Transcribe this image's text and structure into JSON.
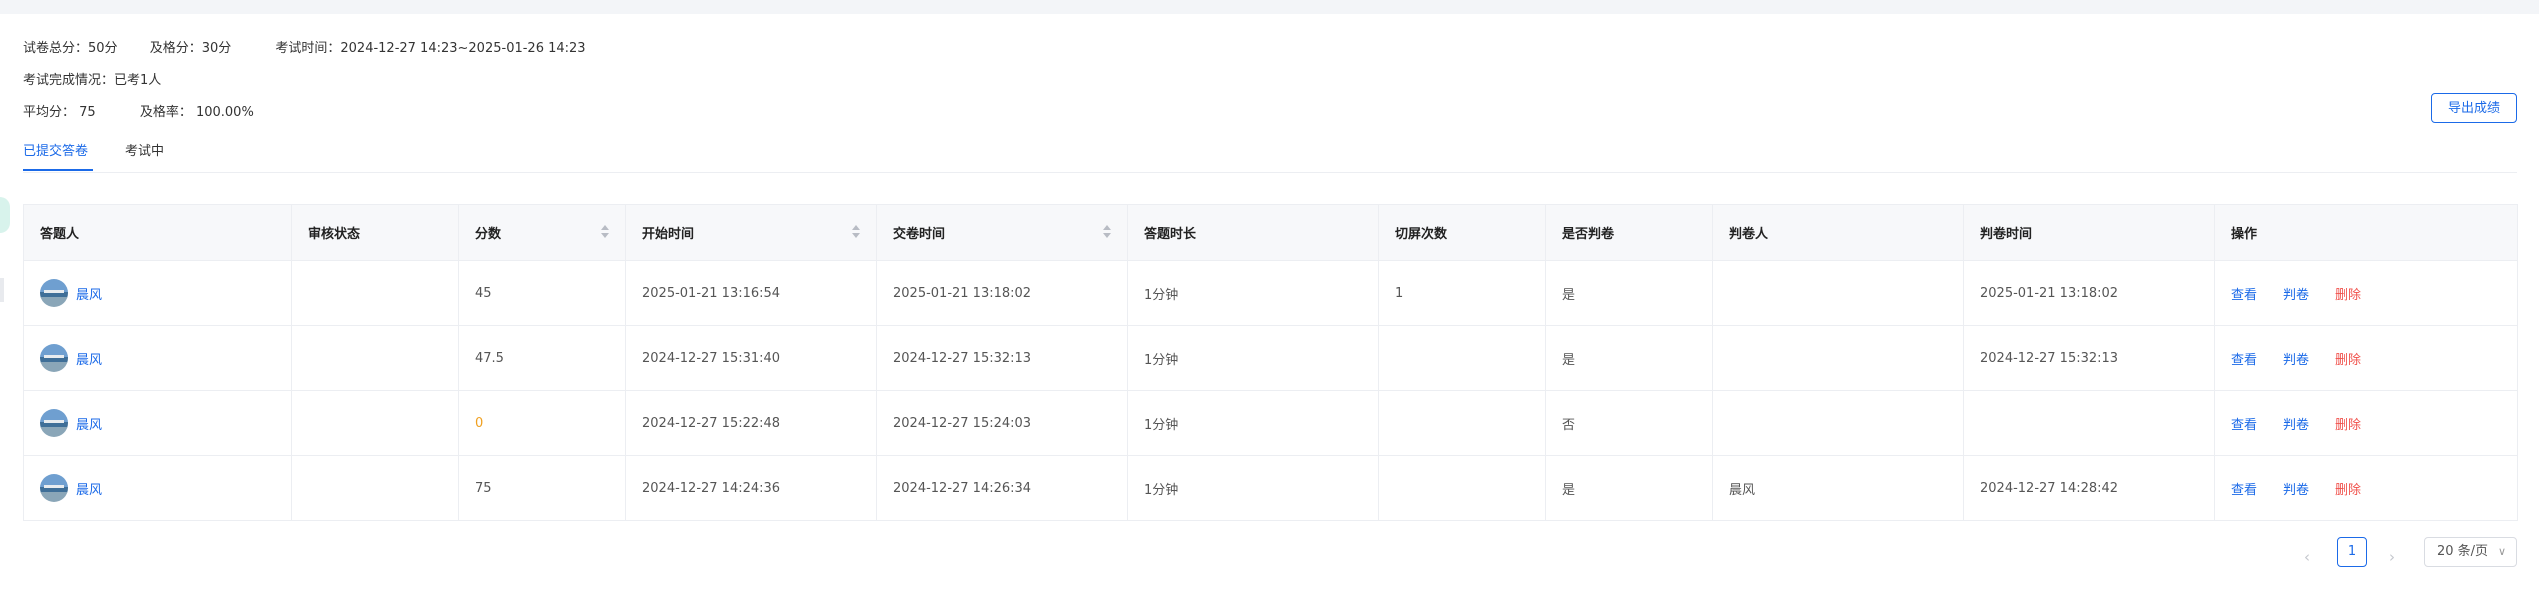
{
  "summary": {
    "total_score": "试卷总分：50分",
    "pass_score": "及格分：30分",
    "exam_time": "考试时间：2024-12-27 14:23~2025-01-26 14:23",
    "completion": "考试完成情况：已考1人",
    "average": "平均分：  75",
    "pass_rate": "及格率：  100.00%"
  },
  "export_button": "导出成绩",
  "tabs": [
    "已提交答卷",
    "考试中"
  ],
  "table": {
    "columns": [
      "答题人",
      "审核状态",
      "分数",
      "开始时间",
      "交卷时间",
      "答题时长",
      "切屏次数",
      "是否判卷",
      "判卷人",
      "判卷时间",
      "操作"
    ],
    "rows": [
      {
        "name": "晨风",
        "review": "",
        "score": "45",
        "start": "2025-01-21 13:16:54",
        "submit": "2025-01-21 13:18:02",
        "duration": "1分钟",
        "switches": "1",
        "graded": "是",
        "grader": "",
        "grade_time": "2025-01-21 13:18:02"
      },
      {
        "name": "晨风",
        "review": "",
        "score": "47.5",
        "start": "2024-12-27 15:31:40",
        "submit": "2024-12-27 15:32:13",
        "duration": "1分钟",
        "switches": "",
        "graded": "是",
        "grader": "",
        "grade_time": "2024-12-27 15:32:13"
      },
      {
        "name": "晨风",
        "review": "",
        "score": "0",
        "start": "2024-12-27 15:22:48",
        "submit": "2024-12-27 15:24:03",
        "duration": "1分钟",
        "switches": "",
        "graded": "否",
        "grader": "",
        "grade_time": ""
      },
      {
        "name": "晨风",
        "review": "",
        "score": "75",
        "start": "2024-12-27 14:24:36",
        "submit": "2024-12-27 14:26:34",
        "duration": "1分钟",
        "switches": "",
        "graded": "是",
        "grader": "晨风",
        "grade_time": "2024-12-27 14:28:42"
      }
    ],
    "actions": {
      "view": "查看",
      "grade": "判卷",
      "delete": "删除"
    }
  },
  "pagination": {
    "current_page": "1",
    "page_size": "20 条/页",
    "prev_icon": "chevron-left-icon",
    "next_icon": "chevron-right-icon"
  },
  "colors": {
    "primary": "#1b6ae8",
    "danger": "#f0504a",
    "warning": "#f0a020"
  }
}
